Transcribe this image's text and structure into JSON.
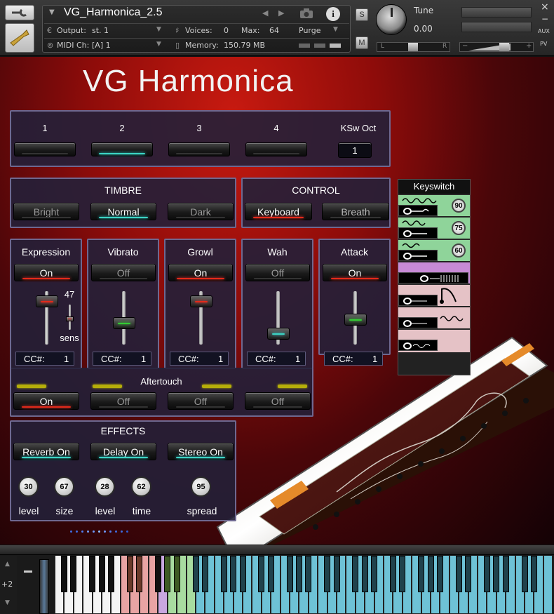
{
  "header": {
    "instrument_name": "VG_Harmonica_2.5",
    "output_label": "Output:",
    "output_value": "st. 1",
    "voices_label": "Voices:",
    "voices_value": "0",
    "max_label": "Max:",
    "max_value": "64",
    "purge_label": "Purge",
    "midi_label": "MIDI Ch:",
    "midi_value": "[A]  1",
    "memory_label": "Memory:",
    "memory_value": "150.79 MB",
    "solo_label": "S",
    "mute_label": "M",
    "tune_label": "Tune",
    "tune_value": "0.00",
    "pan_left": "L",
    "pan_right": "R",
    "vol_minus": "−",
    "vol_plus": "+",
    "close_label": "×",
    "minimize_label": "−",
    "aux_label": "AUX",
    "pv_label": "PV"
  },
  "title": "VG Harmonica",
  "keyswitch_top": {
    "labels": [
      "1",
      "2",
      "3",
      "4"
    ],
    "active_index": 1,
    "ksw_oct_label": "KSw Oct",
    "ksw_oct_value": "1"
  },
  "timbre": {
    "title": "TIMBRE",
    "buttons": [
      {
        "label": "Bright",
        "state": "off"
      },
      {
        "label": "Normal",
        "state": "on"
      },
      {
        "label": "Dark",
        "state": "off"
      }
    ]
  },
  "control": {
    "title": "CONTROL",
    "buttons": [
      {
        "label": "Keyboard",
        "state": "on"
      },
      {
        "label": "Breath",
        "state": "off"
      }
    ]
  },
  "mods": [
    {
      "title": "Expression",
      "state": "On",
      "cc_label": "CC#:",
      "cc_value": "1",
      "slider_level": 0.1,
      "sens_value": "47",
      "sens_label": "sens"
    },
    {
      "title": "Vibrato",
      "state": "Off",
      "cc_label": "CC#:",
      "cc_value": "1",
      "slider_level": 0.63
    },
    {
      "title": "Growl",
      "state": "On",
      "cc_label": "CC#:",
      "cc_value": "1",
      "slider_level": 0.1
    },
    {
      "title": "Wah",
      "state": "Off",
      "cc_label": "CC#:",
      "cc_value": "1",
      "slider_level": 0.88
    },
    {
      "title": "Attack",
      "state": "On",
      "cc_label": "CC#:",
      "cc_value": "1",
      "slider_level": 0.55
    }
  ],
  "aftertouch": {
    "title": "Aftertouch",
    "buttons": [
      "On",
      "Off",
      "Off",
      "Off"
    ]
  },
  "effects": {
    "title": "EFFECTS",
    "buttons": [
      "Reverb On",
      "Delay On",
      "Stereo On"
    ],
    "knobs": [
      {
        "value": "30",
        "label": "level"
      },
      {
        "value": "67",
        "label": "size"
      },
      {
        "value": "28",
        "label": "level"
      },
      {
        "value": "62",
        "label": "time"
      },
      {
        "value": "95",
        "label": "spread"
      }
    ]
  },
  "keyswitch_panel": {
    "title": "Keyswitch",
    "rows": [
      {
        "value": "90",
        "color": "#8fd49a"
      },
      {
        "value": "75",
        "color": "#8fd49a"
      },
      {
        "value": "60",
        "color": "#8fd49a"
      },
      {
        "value": "",
        "color": "#c78ad6"
      },
      {
        "value": "",
        "color": "#e5c2c6"
      },
      {
        "value": "",
        "color": "#e5c2c6"
      },
      {
        "value": "",
        "color": "#e5c2c6"
      }
    ]
  },
  "keyboard": {
    "octave_label": "+2"
  },
  "colors": {
    "accent_red": "#e32a1a",
    "accent_teal": "#3cd4c4",
    "panel_bg": "#24203a",
    "panel_border": "#6e6890"
  }
}
